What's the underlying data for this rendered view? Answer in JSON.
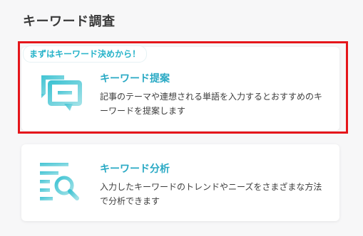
{
  "page": {
    "title": "キーワード調査"
  },
  "badge": {
    "label": "まずはキーワード決めから！"
  },
  "cards": [
    {
      "title": "キーワード提案",
      "description": "記事のテーマや連想される単語を入力するとおすすめのキーワードを提案します",
      "icon": "chat-bubbles-icon"
    },
    {
      "title": "キーワード分析",
      "description": "入力したキーワードのトレンドやニーズをさまざまな方法で分析できます",
      "icon": "list-search-icon"
    }
  ],
  "colors": {
    "accent": "#29a9c4",
    "highlight_border": "#e5161b",
    "icon_gradient_start": "#3fc3d3",
    "icon_gradient_end": "#9fe1e7"
  }
}
